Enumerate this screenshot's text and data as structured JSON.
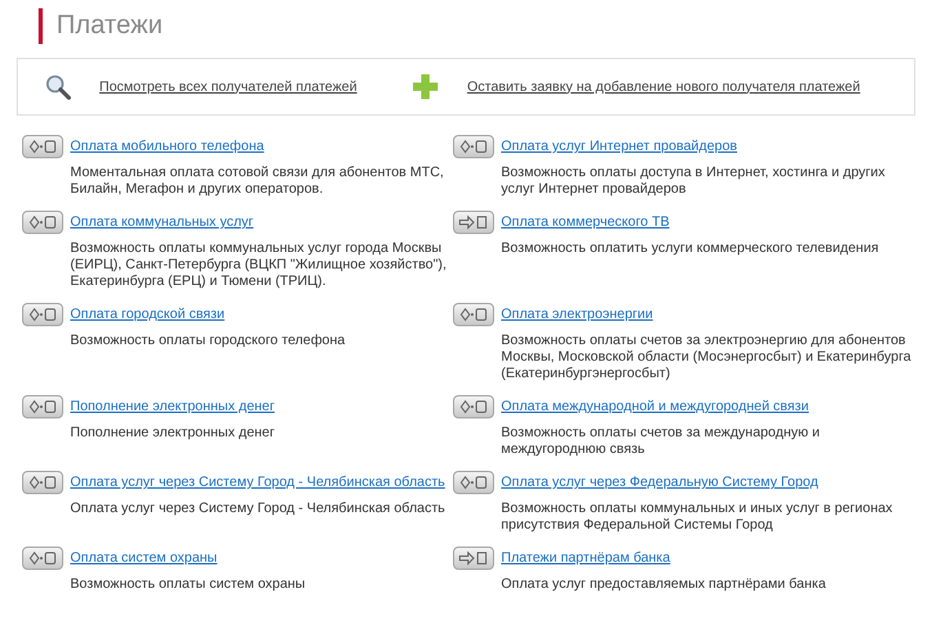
{
  "title": "Платежи",
  "actions": [
    {
      "kind": "search",
      "label": "Посмотреть всех получателей платежей"
    },
    {
      "kind": "add",
      "label": "Оставить заявку на добавление нового получателя платежей"
    }
  ],
  "services": [
    {
      "kind": "pay",
      "title": "Оплата мобильного телефона",
      "description": "Моментальная оплата сотовой связи для абонентов МТС, Билайн, Мегафон и других операторов."
    },
    {
      "kind": "pay",
      "title": "Оплата услуг Интернет провайдеров",
      "description": "Возможность оплаты доступа в Интернет, хостинга и других услуг Интернет провайдеров"
    },
    {
      "kind": "pay",
      "title": "Оплата коммунальных услуг",
      "description": "Возможность оплаты коммунальных услуг города Москвы (ЕИРЦ), Санкт-Петербурга (ВЦКП \"Жилищное хозяйство\"), Екатеринбурга (ЕРЦ) и Тюмени (ТРИЦ)."
    },
    {
      "kind": "transfer",
      "title": "Оплата коммерческого ТВ",
      "description": "Возможность оплатить услуги коммерческого телевидения"
    },
    {
      "kind": "pay",
      "title": "Оплата городской связи",
      "description": "Возможность оплаты городского телефона"
    },
    {
      "kind": "pay",
      "title": "Оплата электроэнергии",
      "description": "Возможность оплаты счетов за электроэнергию для абонентов Москвы, Московской области (Мосэнергосбыт) и Екатеринбурга (Екатеринбургэнергосбыт)"
    },
    {
      "kind": "pay",
      "title": "Пополнение электронных денег",
      "description": "Пополнение электронных денег"
    },
    {
      "kind": "pay",
      "title": "Оплата международной и междугородней связи",
      "description": "Возможность оплаты счетов за международную и междугороднюю связь"
    },
    {
      "kind": "pay",
      "title": "Оплата услуг через Систему Город - Челябинская область",
      "description": "Оплата услуг через Систему Город - Челябинская область"
    },
    {
      "kind": "pay",
      "title": "Оплата услуг через Федеральную Систему Город",
      "description": "Возможность оплаты коммунальных и иных услуг в регионах присутствия Федеральной Системы Город"
    },
    {
      "kind": "pay",
      "title": "Оплата систем охраны",
      "description": "Возможность оплаты систем охраны"
    },
    {
      "kind": "transfer",
      "title": "Платежи партнёрам банка",
      "description": "Оплата услуг предоставляемых партнёрами банка"
    }
  ]
}
